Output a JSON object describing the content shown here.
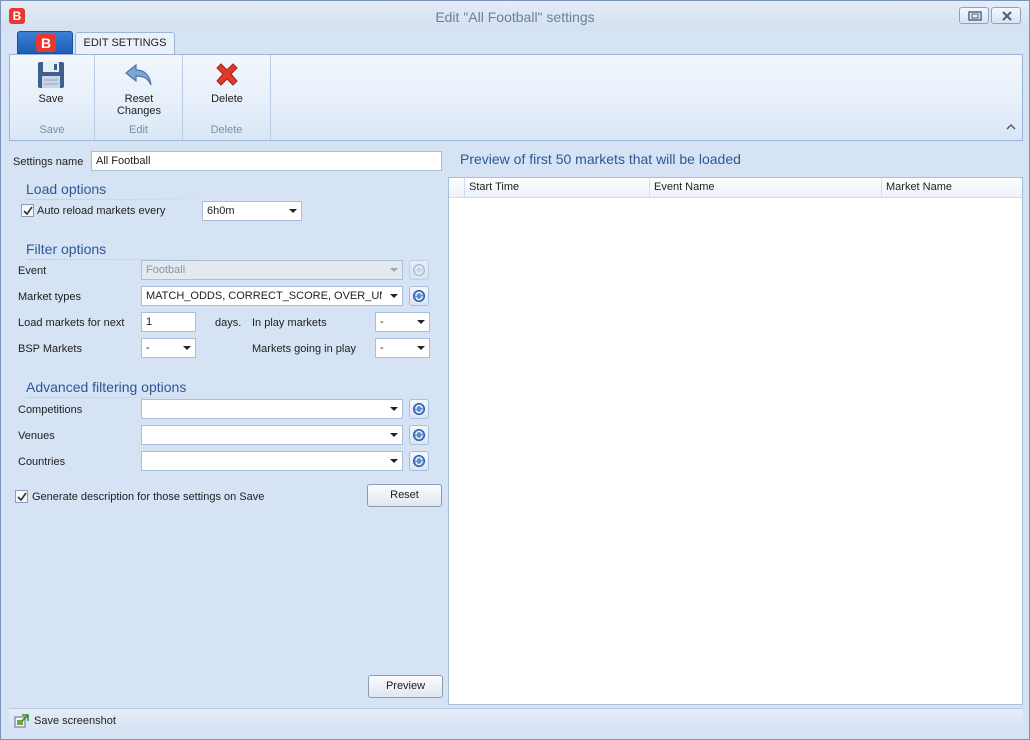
{
  "window": {
    "title": "Edit \"All Football\" settings",
    "app_logo_letter": "B"
  },
  "ribbon": {
    "tab_label": "EDIT SETTINGS",
    "save": {
      "label": "Save",
      "group": "Save",
      "icon": "floppy-disk-icon"
    },
    "reset": {
      "label_line1": "Reset",
      "label_line2": "Changes",
      "group": "Edit",
      "icon": "undo-arrow-icon"
    },
    "delete": {
      "label": "Delete",
      "group": "Delete",
      "icon": "red-x-icon"
    }
  },
  "form": {
    "settings_name_label": "Settings name",
    "settings_name_value": "All Football",
    "load_options_title": "Load options",
    "auto_reload_label": "Auto reload markets every",
    "auto_reload_checked": true,
    "auto_reload_value": "6h0m",
    "filter_options_title": "Filter options",
    "event_label": "Event",
    "event_value": "Football",
    "market_types_label": "Market types",
    "market_types_value": "MATCH_ODDS, CORRECT_SCORE, OVER_UND...",
    "load_next_label": "Load markets for next",
    "load_next_value": "1",
    "days_label": "days.",
    "in_play_label": "In play markets",
    "in_play_value": "-",
    "bsp_label": "BSP Markets",
    "bsp_value": "-",
    "going_in_play_label": "Markets going in play",
    "going_in_play_value": "-",
    "advanced_title": "Advanced filtering options",
    "competitions_label": "Competitions",
    "competitions_value": "",
    "venues_label": "Venues",
    "venues_value": "",
    "countries_label": "Countries",
    "countries_value": "",
    "generate_desc_label": "Generate description for those settings on Save",
    "generate_desc_checked": true,
    "reset_button": "Reset",
    "preview_button": "Preview"
  },
  "preview": {
    "title": "Preview of first 50 markets that will be loaded",
    "columns": [
      "Start Time",
      "Event Name",
      "Market Name"
    ],
    "rows": []
  },
  "statusbar": {
    "text": "Save screenshot",
    "icon": "screenshot-export-icon"
  },
  "colors": {
    "accent_blue": "#2d5896",
    "brand_red": "#e8392e",
    "background": "#d5e3f5"
  }
}
